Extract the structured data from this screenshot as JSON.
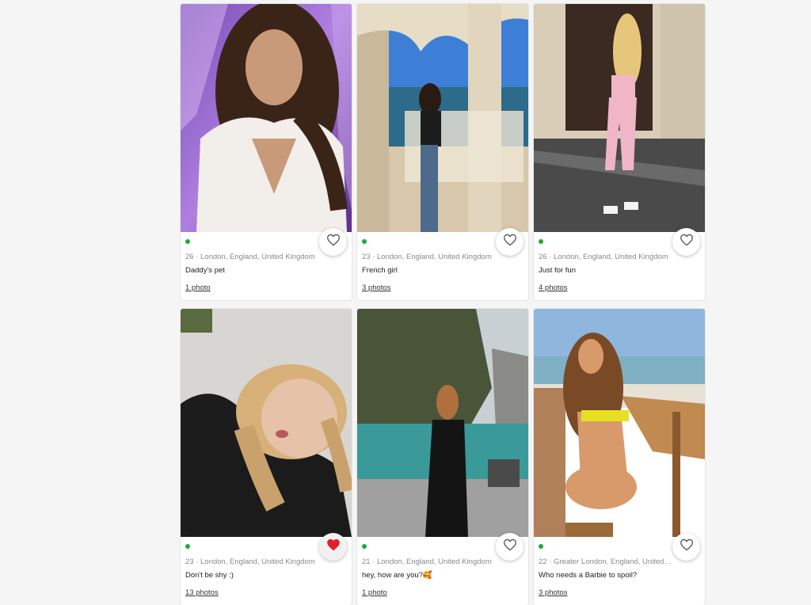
{
  "profiles": [
    {
      "meta": "26 · London, England, United Kingdom",
      "caption": "Daddy's pet",
      "photos": "1 photo",
      "favorited": false,
      "online": true,
      "photo_icon": "profile-photo"
    },
    {
      "meta": "23 · London, England, United Kingdom",
      "caption": "French girl",
      "photos": "3 photos",
      "favorited": false,
      "online": true,
      "photo_icon": "profile-photo"
    },
    {
      "meta": "26 · London, England, United Kingdom",
      "caption": "Just for fun",
      "photos": "4 photos",
      "favorited": false,
      "online": true,
      "photo_icon": "profile-photo"
    },
    {
      "meta": "23 · London, England, United Kingdom",
      "caption": "Don't be shy :)",
      "photos": "13 photos",
      "favorited": true,
      "online": true,
      "photo_icon": "profile-photo"
    },
    {
      "meta": "21 · London, England, United Kingdom",
      "caption": "hey, how are you?🥰",
      "photos": "1 photo",
      "favorited": false,
      "online": true,
      "photo_icon": "profile-photo"
    },
    {
      "meta": "22 · Greater London, England, United…",
      "caption": "Who needs a Barbie to spoil?",
      "photos": "3 photos",
      "favorited": false,
      "online": true,
      "photo_icon": "profile-photo"
    }
  ],
  "colors": {
    "online": "#1fa83a",
    "heart_active": "#e0202a",
    "heart_outline": "#555555"
  }
}
